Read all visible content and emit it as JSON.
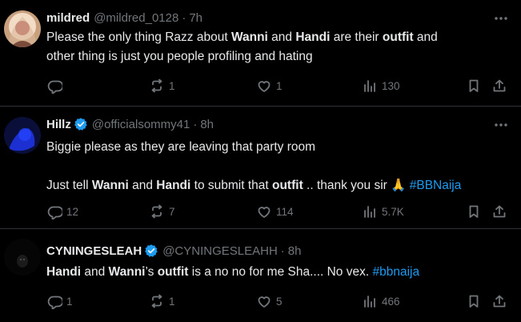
{
  "tweets": [
    {
      "name": "mildred",
      "handle": "@mildred_0128",
      "time": "7h",
      "verified": false,
      "body_lines": [
        [
          {
            "t": "Please the only thing Razz about "
          },
          {
            "t": "Wanni",
            "b": true
          },
          {
            "t": " and "
          },
          {
            "t": "Handi",
            "b": true
          },
          {
            "t": " are their "
          },
          {
            "t": "outfit",
            "b": true
          },
          {
            "t": " and"
          }
        ],
        [
          {
            "t": "other thing is just you people profiling and hating"
          }
        ]
      ],
      "replies": "",
      "retweets": "1",
      "likes": "1",
      "views": "130"
    },
    {
      "name": "Hillz",
      "handle": "@officialsommy41",
      "time": "8h",
      "verified": true,
      "body_lines": [
        [
          {
            "t": "Biggie please as they are leaving that party room"
          }
        ],
        [],
        [
          {
            "t": "Just tell "
          },
          {
            "t": "Wanni",
            "b": true
          },
          {
            "t": " and "
          },
          {
            "t": "Handi",
            "b": true
          },
          {
            "t": " to submit that "
          },
          {
            "t": "outfit",
            "b": true
          },
          {
            "t": " .. thank you sir 🙏 "
          },
          {
            "t": "#BBNaija",
            "tag": true
          }
        ]
      ],
      "replies": "12",
      "retweets": "7",
      "likes": "114",
      "views": "5.7K"
    },
    {
      "name": "CYNINGESLEAH",
      "handle": "@CYNINGESLEAHH",
      "time": "8h",
      "verified": true,
      "body_lines": [
        [
          {
            "t": "Handi",
            "b": true
          },
          {
            "t": " and "
          },
          {
            "t": "Wanni",
            "b": true
          },
          {
            "t": "’s "
          },
          {
            "t": "outfit",
            "b": true
          },
          {
            "t": " is a no no for me Sha.... No vex. "
          },
          {
            "t": "#bbnaija",
            "tag": true
          }
        ]
      ],
      "replies": "1",
      "retweets": "1",
      "likes": "5",
      "views": "466"
    }
  ],
  "separator": "·",
  "colors": {
    "background": "#000000",
    "text": "#e7e9ea",
    "muted": "#71767b",
    "accent": "#1d9bf0",
    "divider": "#2f3336"
  },
  "icons": [
    "reply-icon",
    "retweet-icon",
    "like-icon",
    "views-icon",
    "bookmark-icon",
    "share-icon",
    "more-icon",
    "verified-badge-icon"
  ]
}
